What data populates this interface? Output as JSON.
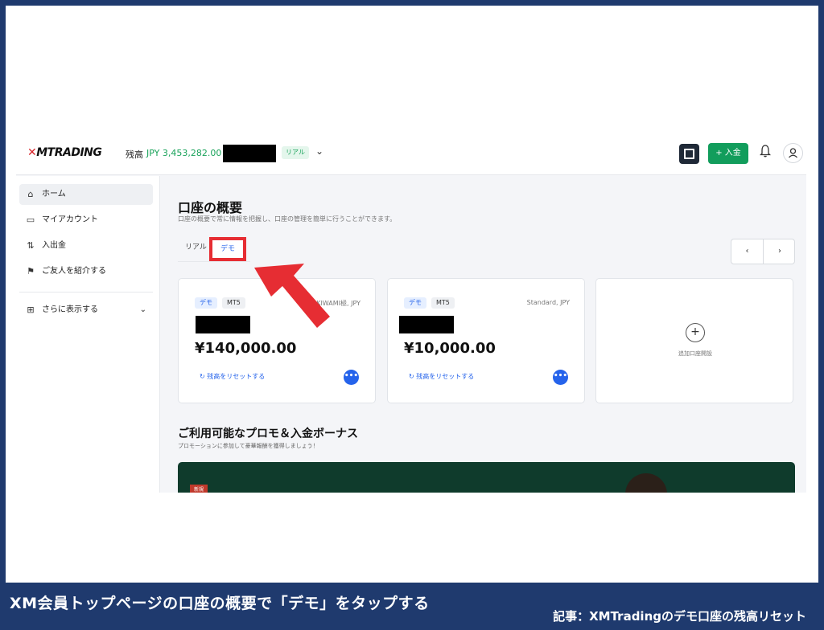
{
  "caption": "XM会員トップページの口座の概要で「デモ」をタップする",
  "article": "記事：XMTradingのデモ口座の残高リセット",
  "header": {
    "logo_x": "✕",
    "logo_text": "MTRADING",
    "balance_label": "残高",
    "balance_value": "JPY 3,453,282.00",
    "account_badge": "リアル",
    "deposit_label": "+ 入金",
    "chevron": "⌄"
  },
  "sidebar": {
    "items": [
      {
        "label": "ホーム",
        "icon": "⌂"
      },
      {
        "label": "マイアカウント",
        "icon": "▭"
      },
      {
        "label": "入出金",
        "icon": "⇅"
      },
      {
        "label": "ご友人を紹介する",
        "icon": "⚑"
      },
      {
        "label": "さらに表示する",
        "icon": "⊞"
      }
    ],
    "chevron": "⌄"
  },
  "main": {
    "title": "口座の概要",
    "subtitle": "口座の概要で常に情報を把握し、口座の管理を簡単に行うことができます。",
    "tabs": [
      {
        "label": "リアル"
      },
      {
        "label": "デモ"
      }
    ],
    "pager": {
      "prev": "‹",
      "next": "›"
    },
    "accounts": [
      {
        "badge": "デモ",
        "platform": "MT5",
        "type": "KIWAMI極, JPY",
        "amount": "¥140,000.00",
        "reset": "↻  残高をリセットする",
        "more": "•••"
      },
      {
        "badge": "デモ",
        "platform": "MT5",
        "type": "Standard, JPY",
        "amount": "¥10,000.00",
        "reset": "↻  残高をリセットする",
        "more": "•••"
      }
    ],
    "add_account": {
      "plus": "+",
      "label": "追加口座開設"
    },
    "promo_title": "ご利用可能なプロモ＆入金ボーナス",
    "promo_sub": "プロモーションに参加して豪華報酬を獲得しましょう！",
    "promo_new": "新規"
  }
}
